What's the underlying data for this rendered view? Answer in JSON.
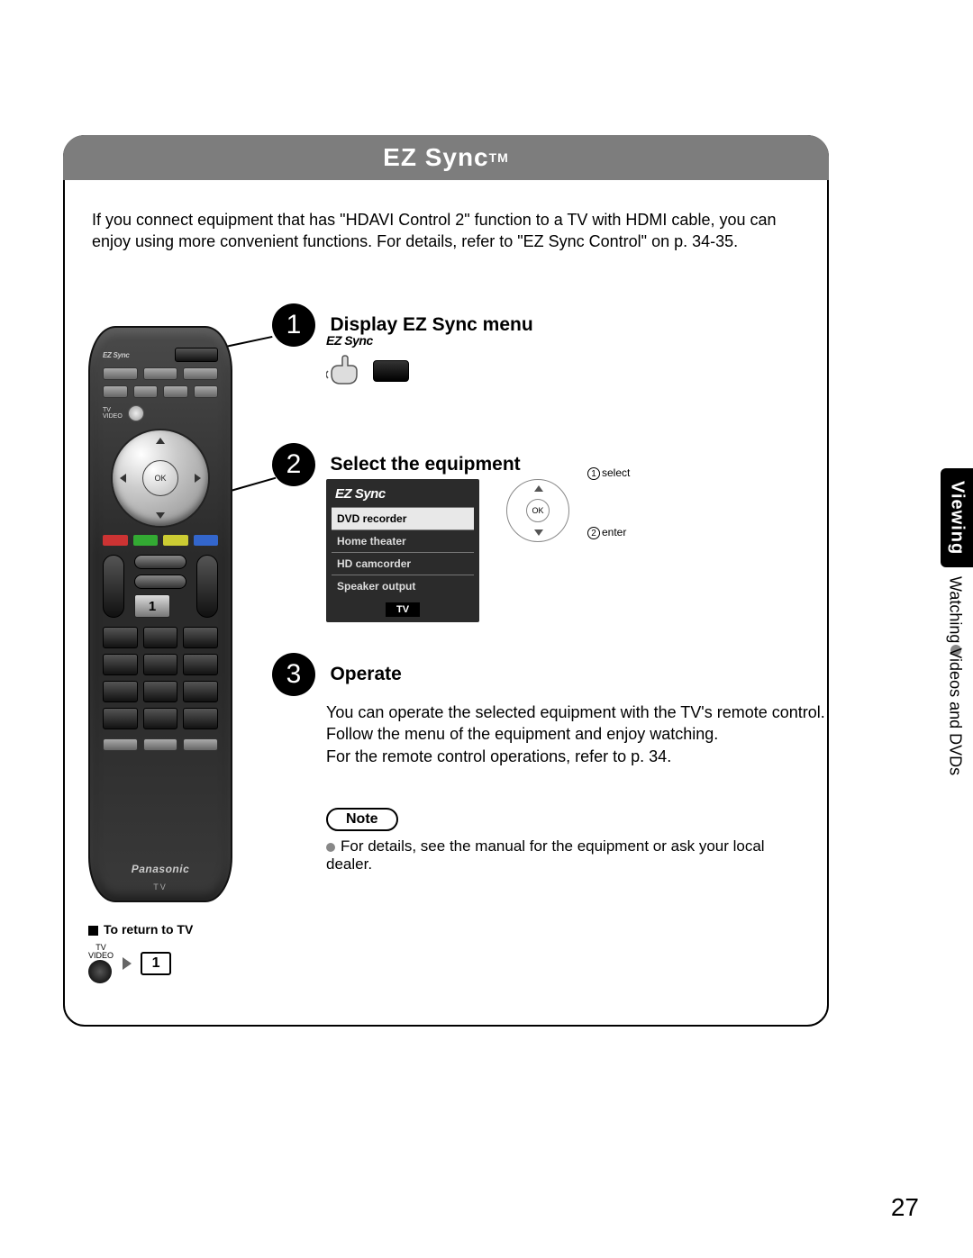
{
  "title": {
    "main": "EZ Sync",
    "tm": "TM"
  },
  "intro": "If you connect equipment that has \"HDAVI Control 2\" function to a TV with HDMI cable, you can enjoy using more convenient functions. For details, refer to \"EZ Sync Control\" on p. 34-35.",
  "steps": {
    "one": {
      "num": "1",
      "title": "Display EZ Sync menu",
      "press_logo": "EZ Sync"
    },
    "two": {
      "num": "2",
      "title": "Select the equipment"
    },
    "three": {
      "num": "3",
      "title": "Operate",
      "lines": [
        "You can operate the selected equipment with the TV's remote control.",
        "Follow the menu of the equipment and enjoy watching.",
        "For the remote control operations, refer to p. 34."
      ]
    }
  },
  "ez_menu": {
    "header": "EZ Sync",
    "items": [
      "DVD recorder",
      "Home theater",
      "HD camcorder",
      "Speaker output"
    ],
    "selected_index": 0,
    "bottom_pill": "TV"
  },
  "dpad": {
    "ok": "OK",
    "label_select": "select",
    "num_select": "1",
    "label_enter": "enter",
    "num_enter": "2"
  },
  "note": {
    "label": "Note",
    "text": "For details, see the manual for the equipment or ask your local dealer."
  },
  "remote": {
    "ez_logo": "EZ Sync",
    "tv_video_label_top": "TV",
    "tv_video_label_bot": "VIDEO",
    "ok": "OK",
    "num_one": "1",
    "brand": "Panasonic",
    "brand_sub": "TV"
  },
  "return": {
    "heading": "To return to TV",
    "label_top": "TV",
    "label_bot": "VIDEO",
    "one": "1"
  },
  "side": {
    "tab": "Viewing",
    "text": "Watching Videos and DVDs"
  },
  "page_number": "27"
}
